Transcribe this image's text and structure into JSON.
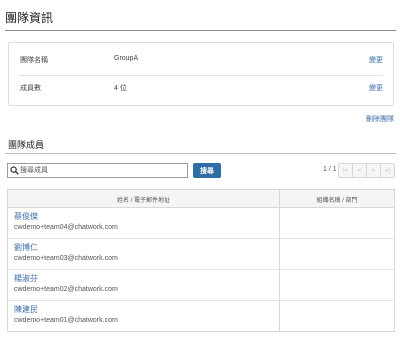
{
  "page_title": "團隊資訊",
  "info": {
    "rows": [
      {
        "label": "團隊名稱",
        "value": "GroupA",
        "action": "變更"
      },
      {
        "label": "成員數",
        "value": "4 位",
        "action": "變更"
      }
    ],
    "delete_team": "刪除團隊"
  },
  "members": {
    "title": "團隊成員",
    "search": {
      "placeholder": "搜尋成員",
      "button": "搜尋"
    },
    "pager": {
      "info": "1 / 1",
      "buttons": [
        "|«",
        "«",
        "»",
        "»|"
      ]
    },
    "table": {
      "headers": [
        "姓名 / 電子郵件地址",
        "組織名稱 / 部門"
      ],
      "rows": [
        {
          "name": "蔡俊傑",
          "email": "cwdemo+team04@chatwork.com"
        },
        {
          "name": "劉博仁",
          "email": "cwdemo+team03@chatwork.com"
        },
        {
          "name": "楊淑芬",
          "email": "cwdemo+team02@chatwork.com"
        },
        {
          "name": "陳建民",
          "email": "cwdemo+team01@chatwork.com"
        }
      ]
    }
  },
  "colors": {
    "link": "#3a6da8",
    "primary_button": "#2e6da4"
  }
}
